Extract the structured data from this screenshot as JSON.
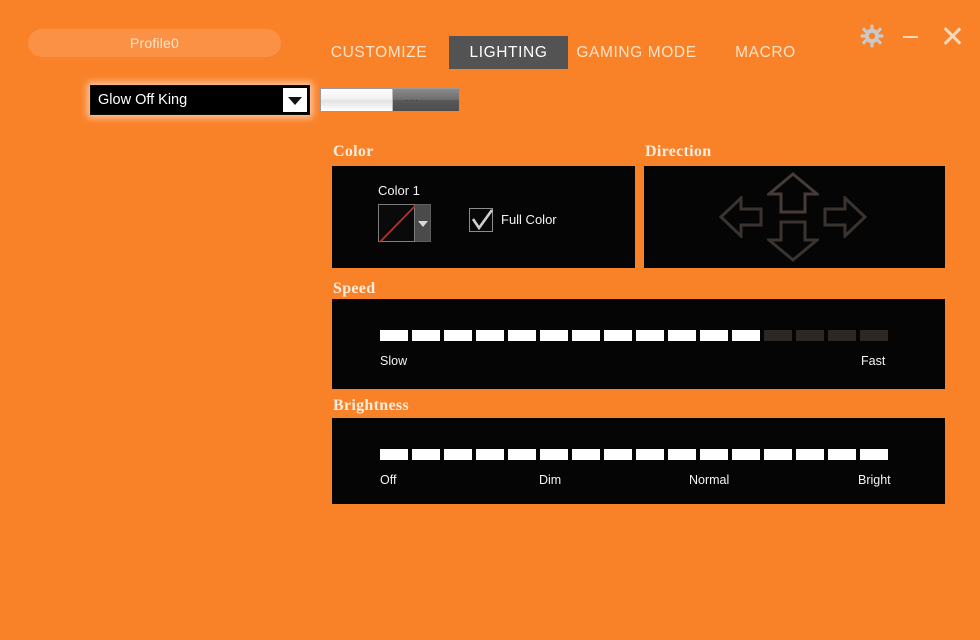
{
  "app": {
    "background_color": "#f98128",
    "panel_color": "#050505"
  },
  "titlebar": {
    "profile_label": "Profile0",
    "gear_icon": "gear-icon",
    "minimize_icon": "minimize-icon",
    "close_icon": "close-icon",
    "tabs": [
      {
        "label": "CUSTOMIZE",
        "active": false
      },
      {
        "label": "LIGHTING",
        "active": true
      },
      {
        "label": "GAMING MODE",
        "active": false
      },
      {
        "label": "MACRO",
        "active": false
      }
    ]
  },
  "effect": {
    "selected": "Glow Off King",
    "dropdown_icon": "chevron-down-icon",
    "scroll_grip_glyph": "···"
  },
  "color": {
    "section_label": "Color",
    "color1_label": "Color 1",
    "swatch_value": "none",
    "swatch_slash_color": "#b3312b",
    "swatch_dropdown_icon": "caret-down-icon",
    "full_color_label": "Full Color",
    "full_color_checked": true
  },
  "direction": {
    "section_label": "Direction",
    "arrows": [
      {
        "name": "up",
        "selected": false
      },
      {
        "name": "down",
        "selected": false
      },
      {
        "name": "left",
        "selected": false
      },
      {
        "name": "right",
        "selected": false
      }
    ],
    "arrow_outline_color": "#3a3330"
  },
  "speed": {
    "section_label": "Speed",
    "total_segments": 16,
    "filled_segments": 12,
    "ticks": [
      {
        "label": "Slow"
      },
      {
        "label": "Fast"
      }
    ]
  },
  "brightness": {
    "section_label": "Brightness",
    "total_segments": 16,
    "filled_segments": 16,
    "ticks": [
      {
        "label": "Off"
      },
      {
        "label": "Dim"
      },
      {
        "label": "Normal"
      },
      {
        "label": "Bright"
      }
    ]
  }
}
